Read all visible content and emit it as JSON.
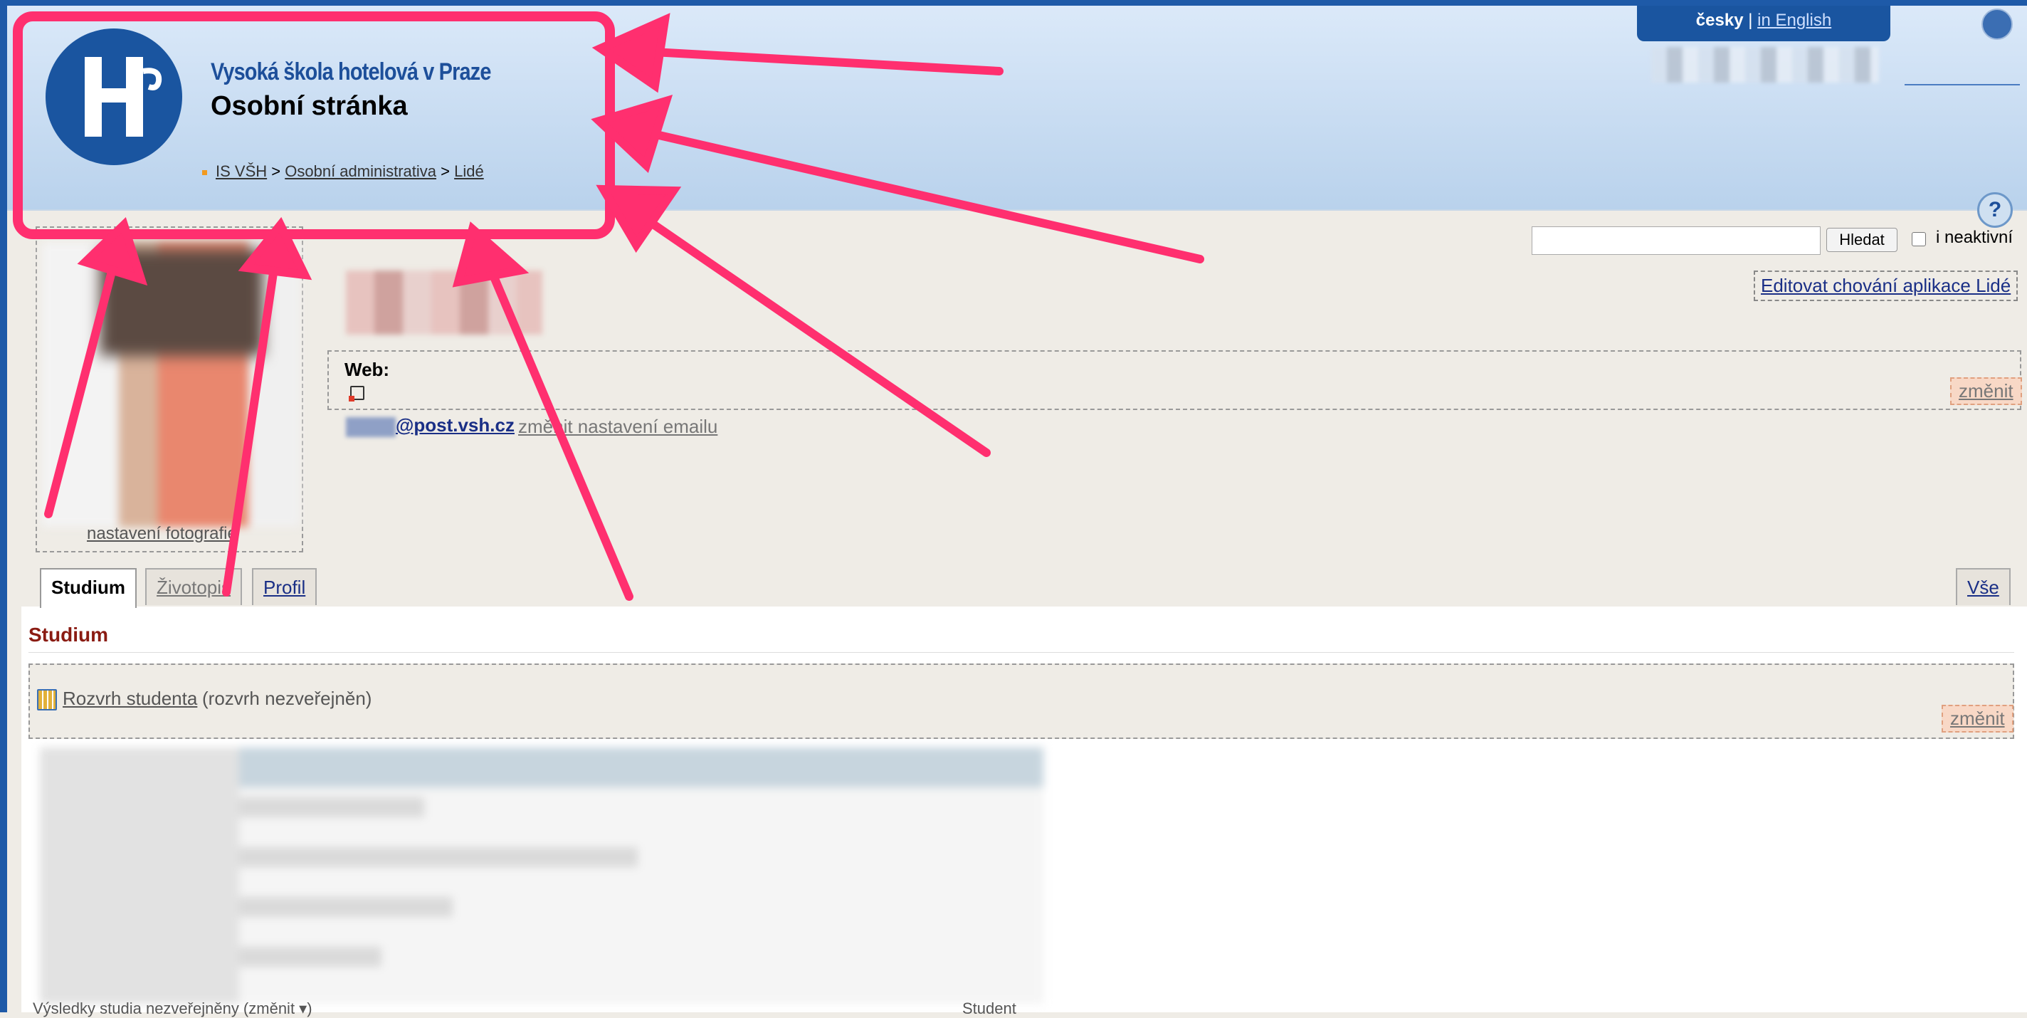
{
  "header": {
    "school_name": "Vysoká škola hotelová v Praze",
    "page_title": "Osobní stránka",
    "breadcrumb": [
      "IS VŠH",
      "Osobní administrativa",
      "Lidé"
    ],
    "separator": ">"
  },
  "language": {
    "current": "česky",
    "separator": "|",
    "other": "in English"
  },
  "help": {
    "label": "?"
  },
  "search": {
    "value": "",
    "button": "Hledat",
    "checkbox_label": "i neaktivní"
  },
  "links": {
    "edit_app": "Editovat chování aplikace Lidé",
    "photo_settings": "nastavení fotografie",
    "change": "změnit",
    "email_settings": "změnit nastavení emailu"
  },
  "profile": {
    "web_label": "Web:",
    "email_domain": "@post.vsh.cz"
  },
  "tabs": [
    "Studium",
    "Životopis",
    "Profil"
  ],
  "tab_all": "Vše",
  "section": {
    "title": "Studium",
    "schedule_link": "Rozvrh studenta",
    "schedule_note": "(rozvrh nezveřejněn)"
  },
  "bottom": {
    "left": "Výsledky studia nezveřejněny (změnit ▾)",
    "right": "Student"
  },
  "colors": {
    "brand": "#1a55a0",
    "annotation": "#ff2f6f",
    "section_title": "#8a1b12"
  }
}
